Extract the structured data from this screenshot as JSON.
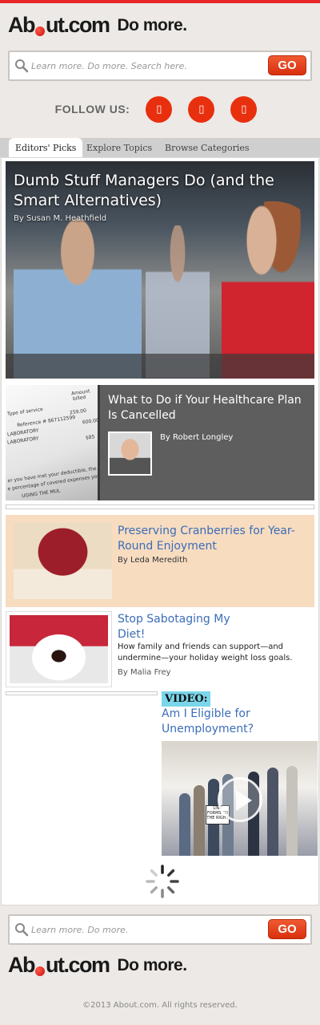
{
  "brand": {
    "logo_text": "About.com",
    "tagline": "Do more."
  },
  "search_top": {
    "placeholder": "Learn more. Do more. Search here.",
    "button": "GO"
  },
  "follow": {
    "label": "FOLLOW US:",
    "icons": [
      "social-icon-1",
      "social-icon-2",
      "social-icon-3"
    ],
    "icon_glyph": "▯"
  },
  "tabs": [
    {
      "label": "Editors' Picks",
      "active": true
    },
    {
      "label": "Explore Topics",
      "active": false
    },
    {
      "label": "Browse Categories",
      "active": false
    }
  ],
  "hero": {
    "title": "Dumb Stuff Managers Do (and the Smart Alternatives)",
    "byline": "By Susan M. Heathfield"
  },
  "card2": {
    "title": "What to Do if Your Healthcare Plan Is Cancelled",
    "byline": "By Robert Longley",
    "doc_lines": [
      "Amount",
      "billed",
      "Type of service",
      "Reference # 867112599",
      "259.00",
      "LABORATORY",
      "600.00",
      "LABORATORY",
      "$85",
      "er you have met your deductible, the co",
      "e percentage of covered expenses you o",
      "UGING THE MUL"
    ]
  },
  "card3": {
    "title": "Preserving Cranberries for Year-Round Enjoyment",
    "byline": "By Leda Meredith"
  },
  "card4": {
    "title": "Stop Sabotaging My Diet!",
    "description": "How family and friends can support—and undermine—your holiday weight loss goals.",
    "byline": "By Malia Frey"
  },
  "card5": {
    "label": "VIDEO:",
    "title": "Am I Eligible for Unemployment?",
    "sign_text": "LINE FORMS TO THE RIGHT"
  },
  "search_bottom": {
    "placeholder": "Learn more. Do more.",
    "button": "GO"
  },
  "footer": {
    "copyright": "©2013 About.com. All rights reserved."
  },
  "colors": {
    "accent": "#e8300e",
    "link": "#3b6db8",
    "topbar": "#e8262a",
    "peach": "#f7dcc0",
    "video_label": "#7ad6ea"
  }
}
